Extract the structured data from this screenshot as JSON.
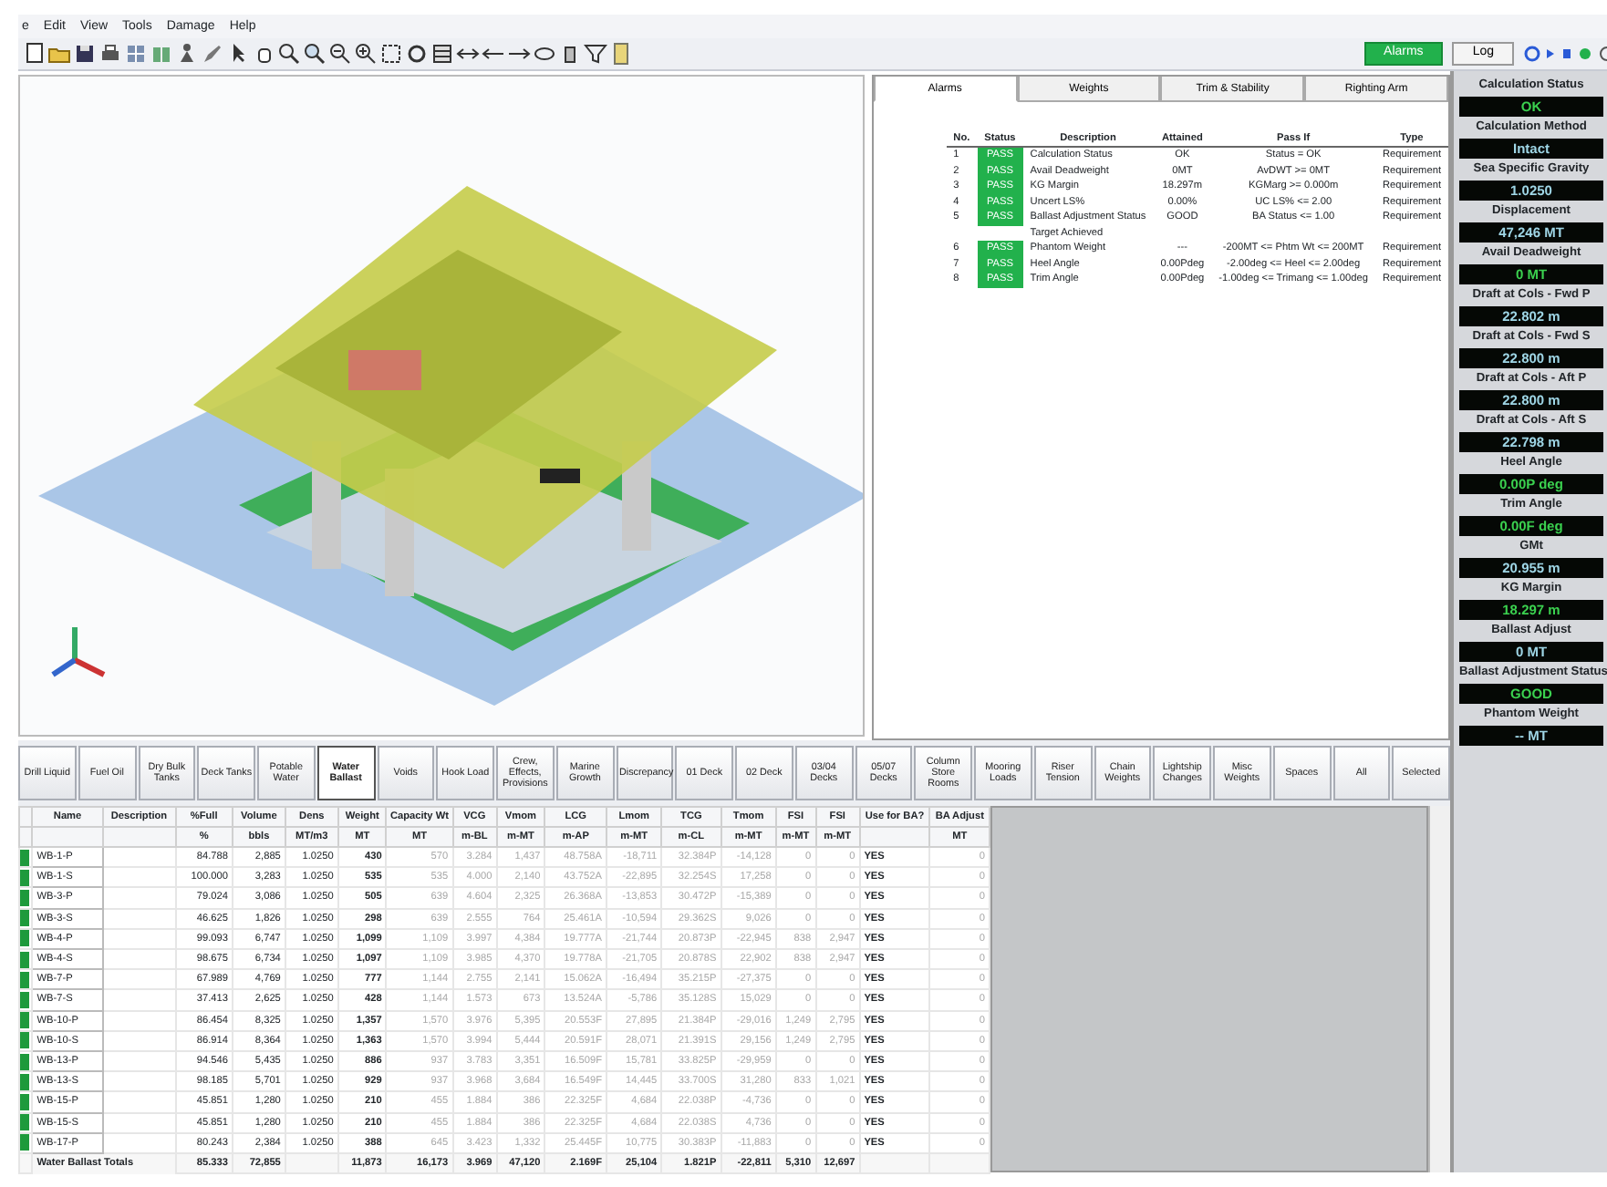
{
  "menu": [
    "e",
    "Edit",
    "View",
    "Tools",
    "Damage",
    "Help"
  ],
  "top_buttons": [
    {
      "label": "Alarms",
      "selected": true
    },
    {
      "label": "Log",
      "selected": false
    }
  ],
  "alarm_tabs": [
    {
      "label": "Alarms",
      "selected": true
    },
    {
      "label": "Weights",
      "selected": false
    },
    {
      "label": "Trim & Stability",
      "selected": false
    },
    {
      "label": "Righting Arm",
      "selected": false
    }
  ],
  "alarm_columns": [
    "No.",
    "Status",
    "Description",
    "Attained",
    "Pass If",
    "Type"
  ],
  "alarm_rows": [
    {
      "kind": "result",
      "no": "1",
      "status": "PASS",
      "description": "Calculation Status",
      "attained": "OK",
      "pass_if": "Status = OK",
      "type": "Requirement"
    },
    {
      "kind": "result",
      "no": "2",
      "status": "PASS",
      "description": "Avail Deadweight",
      "attained": "0MT",
      "pass_if": "AvDWT >= 0MT",
      "type": "Requirement"
    },
    {
      "kind": "result",
      "no": "3",
      "status": "PASS",
      "description": "KG Margin",
      "attained": "18.297m",
      "pass_if": "KGMarg >= 0.000m",
      "type": "Requirement"
    },
    {
      "kind": "result",
      "no": "4",
      "status": "PASS",
      "description": "Uncert LS%",
      "attained": "0.00%",
      "pass_if": "UC LS% <= 2.00",
      "type": "Requirement"
    },
    {
      "kind": "result",
      "no": "5",
      "status": "PASS",
      "description": "Ballast Adjustment Status",
      "attained": "GOOD",
      "pass_if": "BA Status <= 1.00",
      "type": "Requirement"
    },
    {
      "kind": "note",
      "description": "Target Achieved"
    },
    {
      "kind": "result",
      "no": "6",
      "status": "PASS",
      "description": "Phantom Weight",
      "attained": "---",
      "pass_if": "-200MT <= Phtm Wt <= 200MT",
      "type": "Requirement"
    },
    {
      "kind": "result",
      "no": "7",
      "status": "PASS",
      "description": "Heel Angle",
      "attained": "0.00Pdeg",
      "pass_if": "-2.00deg <= Heel <= 2.00deg",
      "type": "Requirement"
    },
    {
      "kind": "result",
      "no": "8",
      "status": "PASS",
      "description": "Trim Angle",
      "attained": "0.00Pdeg",
      "pass_if": "-1.00deg <= Trimang <= 1.00deg",
      "type": "Requirement"
    }
  ],
  "categories": [
    {
      "label": "Drill Liquid",
      "selected": false
    },
    {
      "label": "Fuel Oil",
      "selected": false
    },
    {
      "label": "Dry Bulk Tanks",
      "selected": false
    },
    {
      "label": "Deck Tanks",
      "selected": false
    },
    {
      "label": "Potable Water",
      "selected": false
    },
    {
      "label": "Water Ballast",
      "selected": true
    },
    {
      "label": "Voids",
      "selected": false
    },
    {
      "label": "Hook Load",
      "selected": false
    },
    {
      "label": "Crew, Effects, Provisions",
      "selected": false
    },
    {
      "label": "Marine Growth",
      "selected": false
    },
    {
      "label": "Discrepancy",
      "selected": false
    },
    {
      "label": "01 Deck",
      "selected": false
    },
    {
      "label": "02 Deck",
      "selected": false
    },
    {
      "label": "03/04 Decks",
      "selected": false
    },
    {
      "label": "05/07 Decks",
      "selected": false
    },
    {
      "label": "Column Store Rooms",
      "selected": false
    },
    {
      "label": "Mooring Loads",
      "selected": false
    },
    {
      "label": "Riser Tension",
      "selected": false
    },
    {
      "label": "Chain Weights",
      "selected": false
    },
    {
      "label": "Lightship Changes",
      "selected": false
    },
    {
      "label": "Misc Weights",
      "selected": false
    },
    {
      "label": "Spaces",
      "selected": false
    },
    {
      "label": "All",
      "selected": false
    },
    {
      "label": "Selected",
      "selected": false
    }
  ],
  "table": {
    "columns": [
      {
        "label": "Name",
        "kind": "name"
      },
      {
        "label": "Description",
        "kind": "text"
      },
      {
        "label": "%Full",
        "unit": "%",
        "kind": "input"
      },
      {
        "label": "Volume",
        "unit": "bbls",
        "kind": "input"
      },
      {
        "label": "Dens",
        "unit": "MT/m3",
        "kind": "input"
      },
      {
        "label": "Weight",
        "unit": "MT",
        "kind": "bold"
      },
      {
        "label": "Capacity Wt",
        "unit": "MT",
        "kind": "faded"
      },
      {
        "label": "VCG",
        "unit": "m-BL",
        "kind": "faded"
      },
      {
        "label": "Vmom",
        "unit": "m-MT",
        "kind": "faded"
      },
      {
        "label": "LCG",
        "unit": "m-AP",
        "kind": "faded"
      },
      {
        "label": "Lmom",
        "unit": "m-MT",
        "kind": "faded"
      },
      {
        "label": "TCG",
        "unit": "m-CL",
        "kind": "faded"
      },
      {
        "label": "Tmom",
        "unit": "m-MT",
        "kind": "faded"
      },
      {
        "label": "FSI",
        "unit": "m-MT",
        "kind": "faded"
      },
      {
        "label": "FSI",
        "unit": "m-MT",
        "kind": "faded"
      },
      {
        "label": "Use for BA?",
        "kind": "flag"
      },
      {
        "label": "BA Adjust",
        "unit": "MT",
        "kind": "faded"
      }
    ],
    "rows": [
      [
        "WB-1-P",
        "",
        "84.788",
        "2,885",
        "1.0250",
        "430",
        "570",
        "3.284",
        "1,437",
        "48.758A",
        "-18,711",
        "32.384P",
        "-14,128",
        "0",
        "0",
        "YES",
        "0"
      ],
      [
        "WB-1-S",
        "",
        "100.000",
        "3,283",
        "1.0250",
        "535",
        "535",
        "4.000",
        "2,140",
        "43.752A",
        "-22,895",
        "32.254S",
        "17,258",
        "0",
        "0",
        "YES",
        "0"
      ],
      [
        "WB-3-P",
        "",
        "79.024",
        "3,086",
        "1.0250",
        "505",
        "639",
        "4.604",
        "2,325",
        "26.368A",
        "-13,853",
        "30.472P",
        "-15,389",
        "0",
        "0",
        "YES",
        "0"
      ],
      [
        "WB-3-S",
        "",
        "46.625",
        "1,826",
        "1.0250",
        "298",
        "639",
        "2.555",
        "764",
        "25.461A",
        "-10,594",
        "29.362S",
        "9,026",
        "0",
        "0",
        "YES",
        "0"
      ],
      [
        "WB-4-P",
        "",
        "99.093",
        "6,747",
        "1.0250",
        "1,099",
        "1,109",
        "3.997",
        "4,384",
        "19.777A",
        "-21,744",
        "20.873P",
        "-22,945",
        "838",
        "2,947",
        "YES",
        "0"
      ],
      [
        "WB-4-S",
        "",
        "98.675",
        "6,734",
        "1.0250",
        "1,097",
        "1,109",
        "3.985",
        "4,370",
        "19.778A",
        "-21,705",
        "20.878S",
        "22,902",
        "838",
        "2,947",
        "YES",
        "0"
      ],
      [
        "WB-7-P",
        "",
        "67.989",
        "4,769",
        "1.0250",
        "777",
        "1,144",
        "2.755",
        "2,141",
        "15.062A",
        "-16,494",
        "35.215P",
        "-27,375",
        "0",
        "0",
        "YES",
        "0"
      ],
      [
        "WB-7-S",
        "",
        "37.413",
        "2,625",
        "1.0250",
        "428",
        "1,144",
        "1.573",
        "673",
        "13.524A",
        "-5,786",
        "35.128S",
        "15,029",
        "0",
        "0",
        "YES",
        "0"
      ],
      [
        "WB-10-P",
        "",
        "86.454",
        "8,325",
        "1.0250",
        "1,357",
        "1,570",
        "3.976",
        "5,395",
        "20.553F",
        "27,895",
        "21.384P",
        "-29,016",
        "1,249",
        "2,795",
        "YES",
        "0"
      ],
      [
        "WB-10-S",
        "",
        "86.914",
        "8,364",
        "1.0250",
        "1,363",
        "1,570",
        "3.994",
        "5,444",
        "20.591F",
        "28,071",
        "21.391S",
        "29,156",
        "1,249",
        "2,795",
        "YES",
        "0"
      ],
      [
        "WB-13-P",
        "",
        "94.546",
        "5,435",
        "1.0250",
        "886",
        "937",
        "3.783",
        "3,351",
        "16.509F",
        "15,781",
        "33.825P",
        "-29,959",
        "0",
        "0",
        "YES",
        "0"
      ],
      [
        "WB-13-S",
        "",
        "98.185",
        "5,701",
        "1.0250",
        "929",
        "937",
        "3.968",
        "3,684",
        "16.549F",
        "14,445",
        "33.700S",
        "31,280",
        "833",
        "1,021",
        "YES",
        "0"
      ],
      [
        "WB-15-P",
        "",
        "45.851",
        "1,280",
        "1.0250",
        "210",
        "455",
        "1.884",
        "386",
        "22.325F",
        "4,684",
        "22.038P",
        "-4,736",
        "0",
        "0",
        "YES",
        "0"
      ],
      [
        "WB-15-S",
        "",
        "45.851",
        "1,280",
        "1.0250",
        "210",
        "455",
        "1.884",
        "386",
        "22.325F",
        "4,684",
        "22.038S",
        "4,736",
        "0",
        "0",
        "YES",
        "0"
      ],
      [
        "WB-17-P",
        "",
        "80.243",
        "2,384",
        "1.0250",
        "388",
        "645",
        "3.423",
        "1,332",
        "25.445F",
        "10,775",
        "30.383P",
        "-11,883",
        "0",
        "0",
        "YES",
        "0"
      ]
    ],
    "totals": {
      "label": "Water Ballast Totals",
      "full": "85.333",
      "volume": "72,855",
      "weight": "11,873",
      "capacity_wt": "16,173",
      "vcg": "3.969",
      "vmom": "47,120",
      "lcg": "2.169F",
      "lmom": "25,104",
      "tcg": "1.821P",
      "tmom": "-22,811",
      "fsi_1": "5,310",
      "fsi_2": "12,697"
    }
  },
  "status_panel": [
    {
      "label": "Calculation Status",
      "value": "OK",
      "color": "#3bd14f"
    },
    {
      "label": "Calculation Method",
      "value": "Intact",
      "color": "#9fd6e6"
    },
    {
      "label": "Sea Specific Gravity",
      "value": "1.0250",
      "color": "#9fd6e6"
    },
    {
      "label": "Displacement",
      "value": "47,246 MT",
      "color": "#9fd6e6"
    },
    {
      "label": "Avail Deadweight",
      "value": "0 MT",
      "color": "#3bd14f"
    },
    {
      "label": "Draft at Cols - Fwd P",
      "value": "22.802 m",
      "color": "#9fd6e6"
    },
    {
      "label": "Draft at Cols - Fwd S",
      "value": "22.800 m",
      "color": "#9fd6e6"
    },
    {
      "label": "Draft at Cols - Aft P",
      "value": "22.800 m",
      "color": "#9fd6e6"
    },
    {
      "label": "Draft at Cols - Aft S",
      "value": "22.798 m",
      "color": "#9fd6e6"
    },
    {
      "label": "Heel Angle",
      "value": "0.00P deg",
      "color": "#3bd14f"
    },
    {
      "label": "Trim Angle",
      "value": "0.00F deg",
      "color": "#3bd14f"
    },
    {
      "label": "GMt",
      "value": "20.955 m",
      "color": "#9fd6e6"
    },
    {
      "label": "KG Margin",
      "value": "18.297 m",
      "color": "#3bd14f"
    },
    {
      "label": "Ballast Adjust",
      "value": "0 MT",
      "color": "#9fd6e6"
    },
    {
      "label": "Ballast Adjustment Status",
      "value": "GOOD",
      "color": "#3bd14f"
    },
    {
      "label": "Phantom Weight",
      "value": "-- MT",
      "color": "#9fd6e6"
    }
  ]
}
